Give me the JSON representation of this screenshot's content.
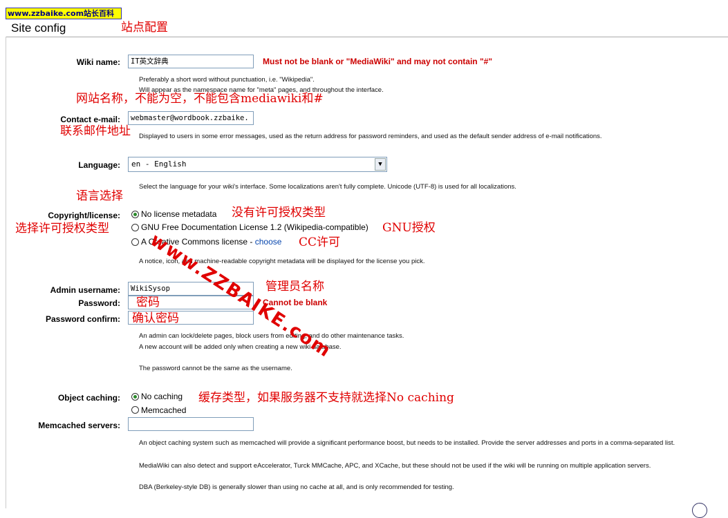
{
  "site_tag": "www.zzbaike.com站长百科",
  "header": {
    "title": "Site config",
    "note": "站点配置"
  },
  "wiki_name": {
    "label": "Wiki name:",
    "value": "IT英文辞典",
    "error": "Must not be blank or \"MediaWiki\" and may not contain \"#\"",
    "help1": "Preferably a short word without punctuation, i.e. \"Wikipedia\".",
    "help2": "Will appear as the namespace name for \"meta\" pages, and throughout the interface.",
    "note": "网站名称，不能为空，不能包含mediawiki和#"
  },
  "contact": {
    "label": "Contact e-mail:",
    "value": "webmaster@wordbook.zzbaike.",
    "note": "联系邮件地址",
    "help": "Displayed to users in some error messages, used as the return address for password reminders, and used as the default sender address of e-mail notifications."
  },
  "language": {
    "label": "Language:",
    "selected": "en - English",
    "help": "Select the language for your wiki's interface. Some localizations aren't fully complete. Unicode (UTF-8) is used for all localizations.",
    "note": "语言选择"
  },
  "copyright": {
    "label": "Copyright/license:",
    "note": "选择许可授权类型",
    "options": [
      {
        "label": "No license metadata",
        "selected": true,
        "note": "没有许可授权类型"
      },
      {
        "label": "GNU Free Documentation License 1.2 (Wikipedia-compatible)",
        "selected": false,
        "note": "GNU授权"
      },
      {
        "label": "A Creative Commons license - ",
        "link": "choose",
        "selected": false,
        "note": "CC许可"
      }
    ],
    "help": "A notice, icon, and machine-readable copyright metadata will be displayed for the license you pick."
  },
  "admin": {
    "username_label": "Admin username:",
    "username_value": "WikiSysop",
    "username_note": "管理员名称",
    "password_label": "Password:",
    "password_note": "密码",
    "password_error": "Cannot be blank",
    "confirm_label": "Password confirm:",
    "confirm_note": "确认密码",
    "help1": "An admin can lock/delete pages, block users from editing, and do other maintenance tasks.",
    "help2": "A new account will be added only when creating a new wiki database.",
    "help3": "The password cannot be the same as the username."
  },
  "caching": {
    "label": "Object caching:",
    "options": [
      {
        "label": "No caching",
        "selected": true
      },
      {
        "label": "Memcached",
        "selected": false
      }
    ],
    "note": "缓存类型，如果服务器不支持就选择No caching",
    "servers_label": "Memcached servers:",
    "servers_value": "",
    "help1": "An object caching system such as memcached will provide a significant performance boost, but needs to be installed. Provide the server addresses and ports in a comma-separated list.",
    "help2": "MediaWiki can also detect and support eAccelerator, Turck MMCache, APC, and XCache, but these should not be used if the wiki will be running on multiple application servers.",
    "help3": "DBA (Berkeley-style DB) is generally slower than using no cache at all, and is only recommended for testing."
  },
  "watermark": "www.ZZBAIKE.com",
  "colors": {
    "annotation": "#e00000",
    "tag_bg": "#ffff00",
    "link": "#0645ad"
  }
}
